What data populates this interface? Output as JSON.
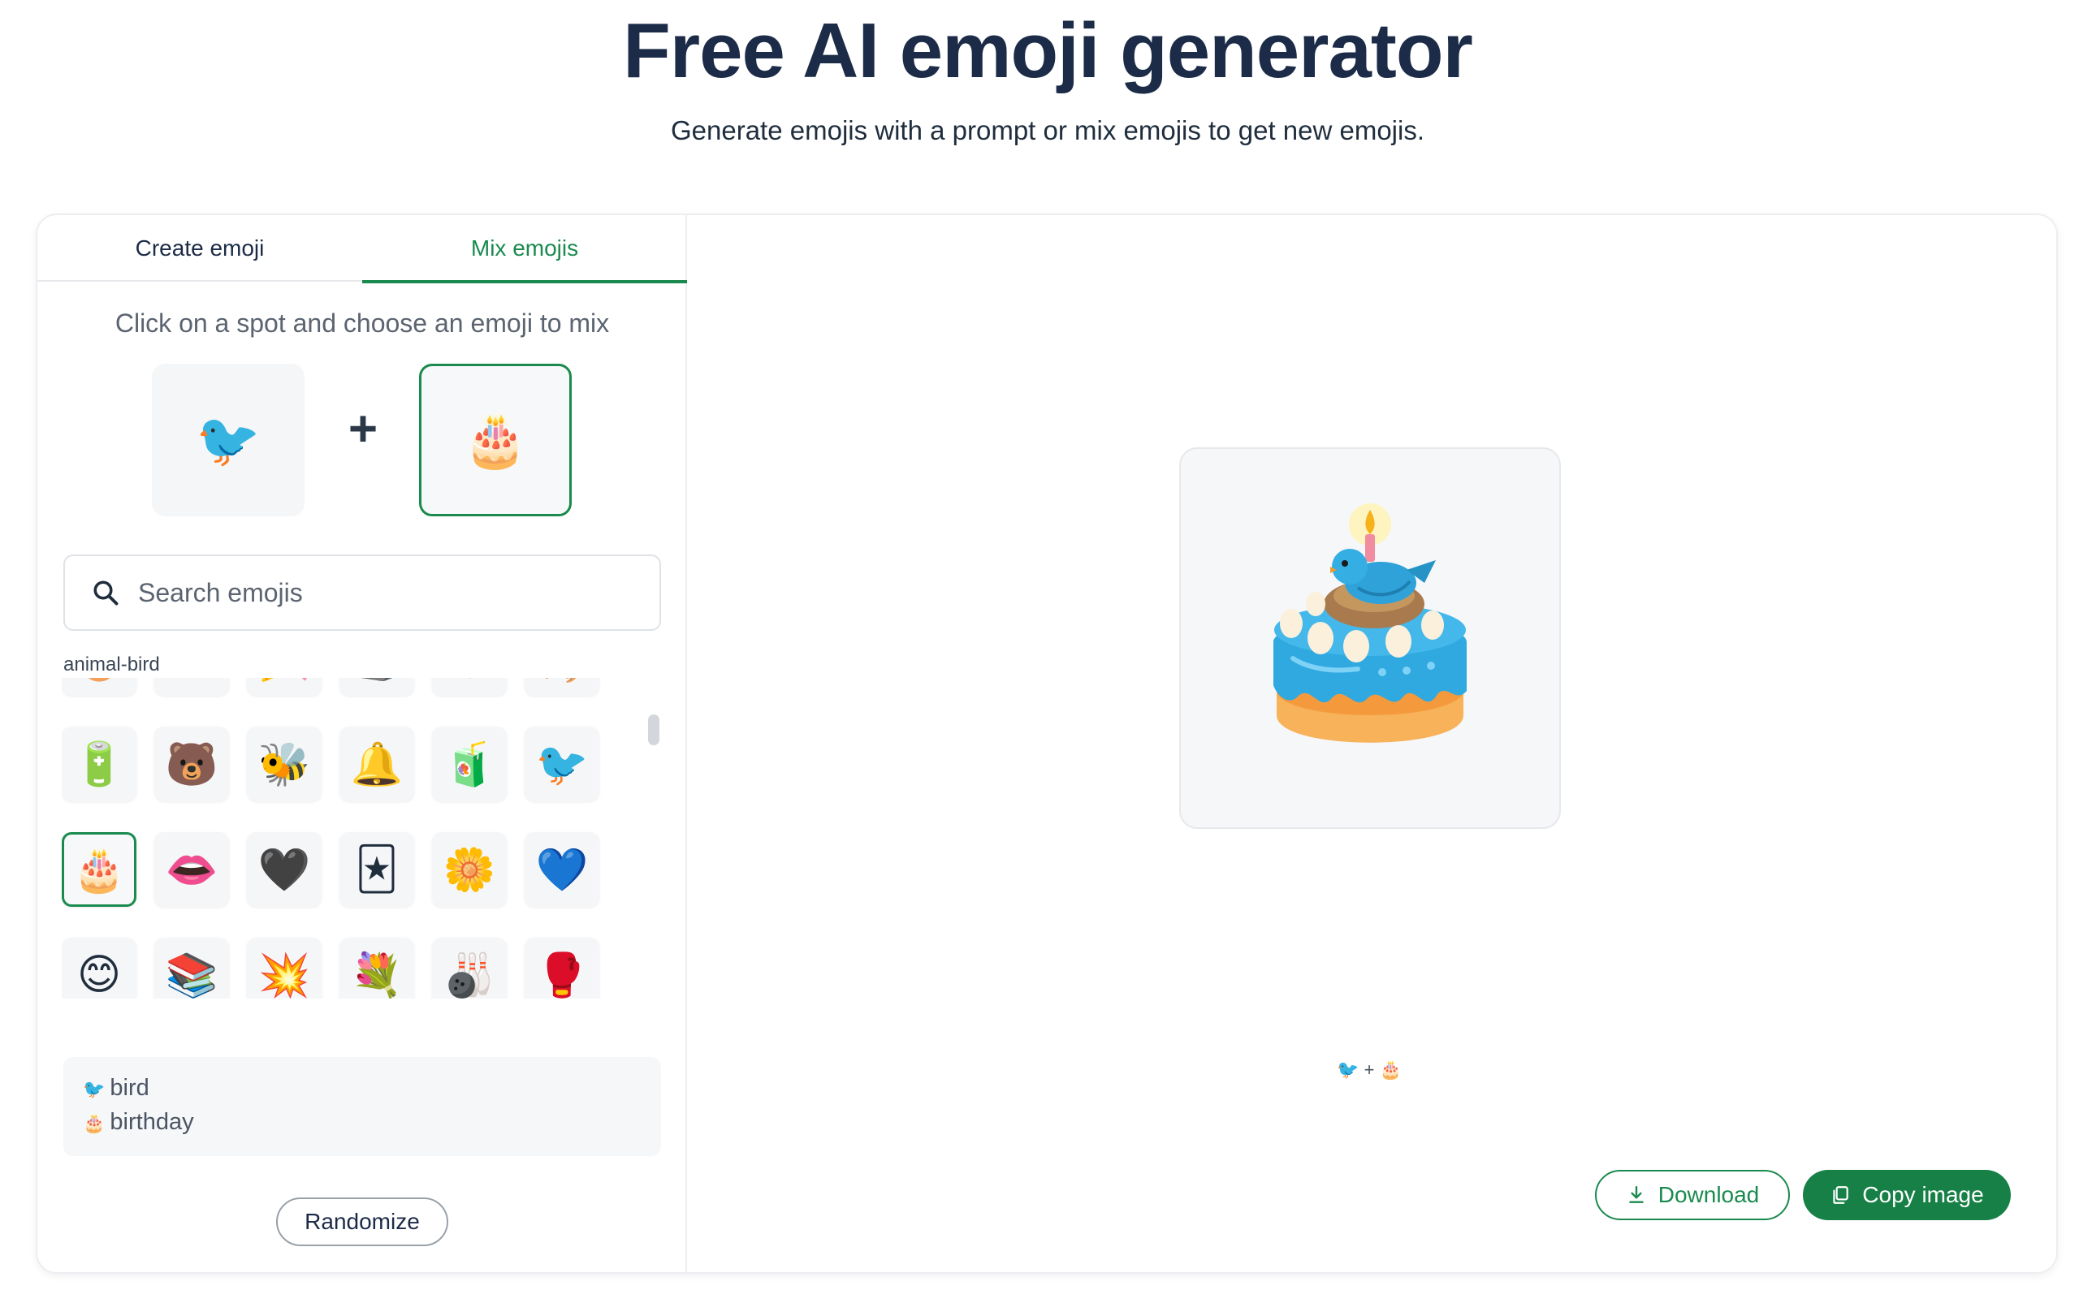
{
  "header": {
    "title": "Free AI emoji generator",
    "subtitle": "Generate emojis with a prompt or mix emojis to get new emojis."
  },
  "tabs": [
    {
      "label": "Create emoji",
      "active": false
    },
    {
      "label": "Mix emojis",
      "active": true
    }
  ],
  "mix": {
    "hint": "Click on a spot and choose an emoji to mix",
    "slot1": "🐦",
    "plus": "+",
    "slot2": "🎂"
  },
  "search": {
    "placeholder": "Search emojis",
    "value": ""
  },
  "category_label": "animal-bird",
  "grid": [
    [
      "🥚",
      "🐟",
      "🎉",
      "🪨",
      "🥨",
      "🦂"
    ],
    [
      "🔋",
      "🐻",
      "🐝",
      "🔔",
      "🧃",
      "🐦"
    ],
    [
      "🎂",
      "👄",
      "🖤",
      "🃏",
      "🌼",
      "💙"
    ],
    [
      "😊",
      "📚",
      "💥",
      "💐",
      "🎳",
      "🥊"
    ]
  ],
  "selection": [
    {
      "emoji": "🐦",
      "name": "bird"
    },
    {
      "emoji": "🎂",
      "name": "birthday"
    }
  ],
  "buttons": {
    "randomize": "Randomize",
    "download": "Download",
    "copy": "Copy image"
  },
  "result": {
    "formula": "🐦 + 🎂"
  },
  "colors": {
    "accent": "#1a8a4e",
    "title": "#1c2b47"
  }
}
